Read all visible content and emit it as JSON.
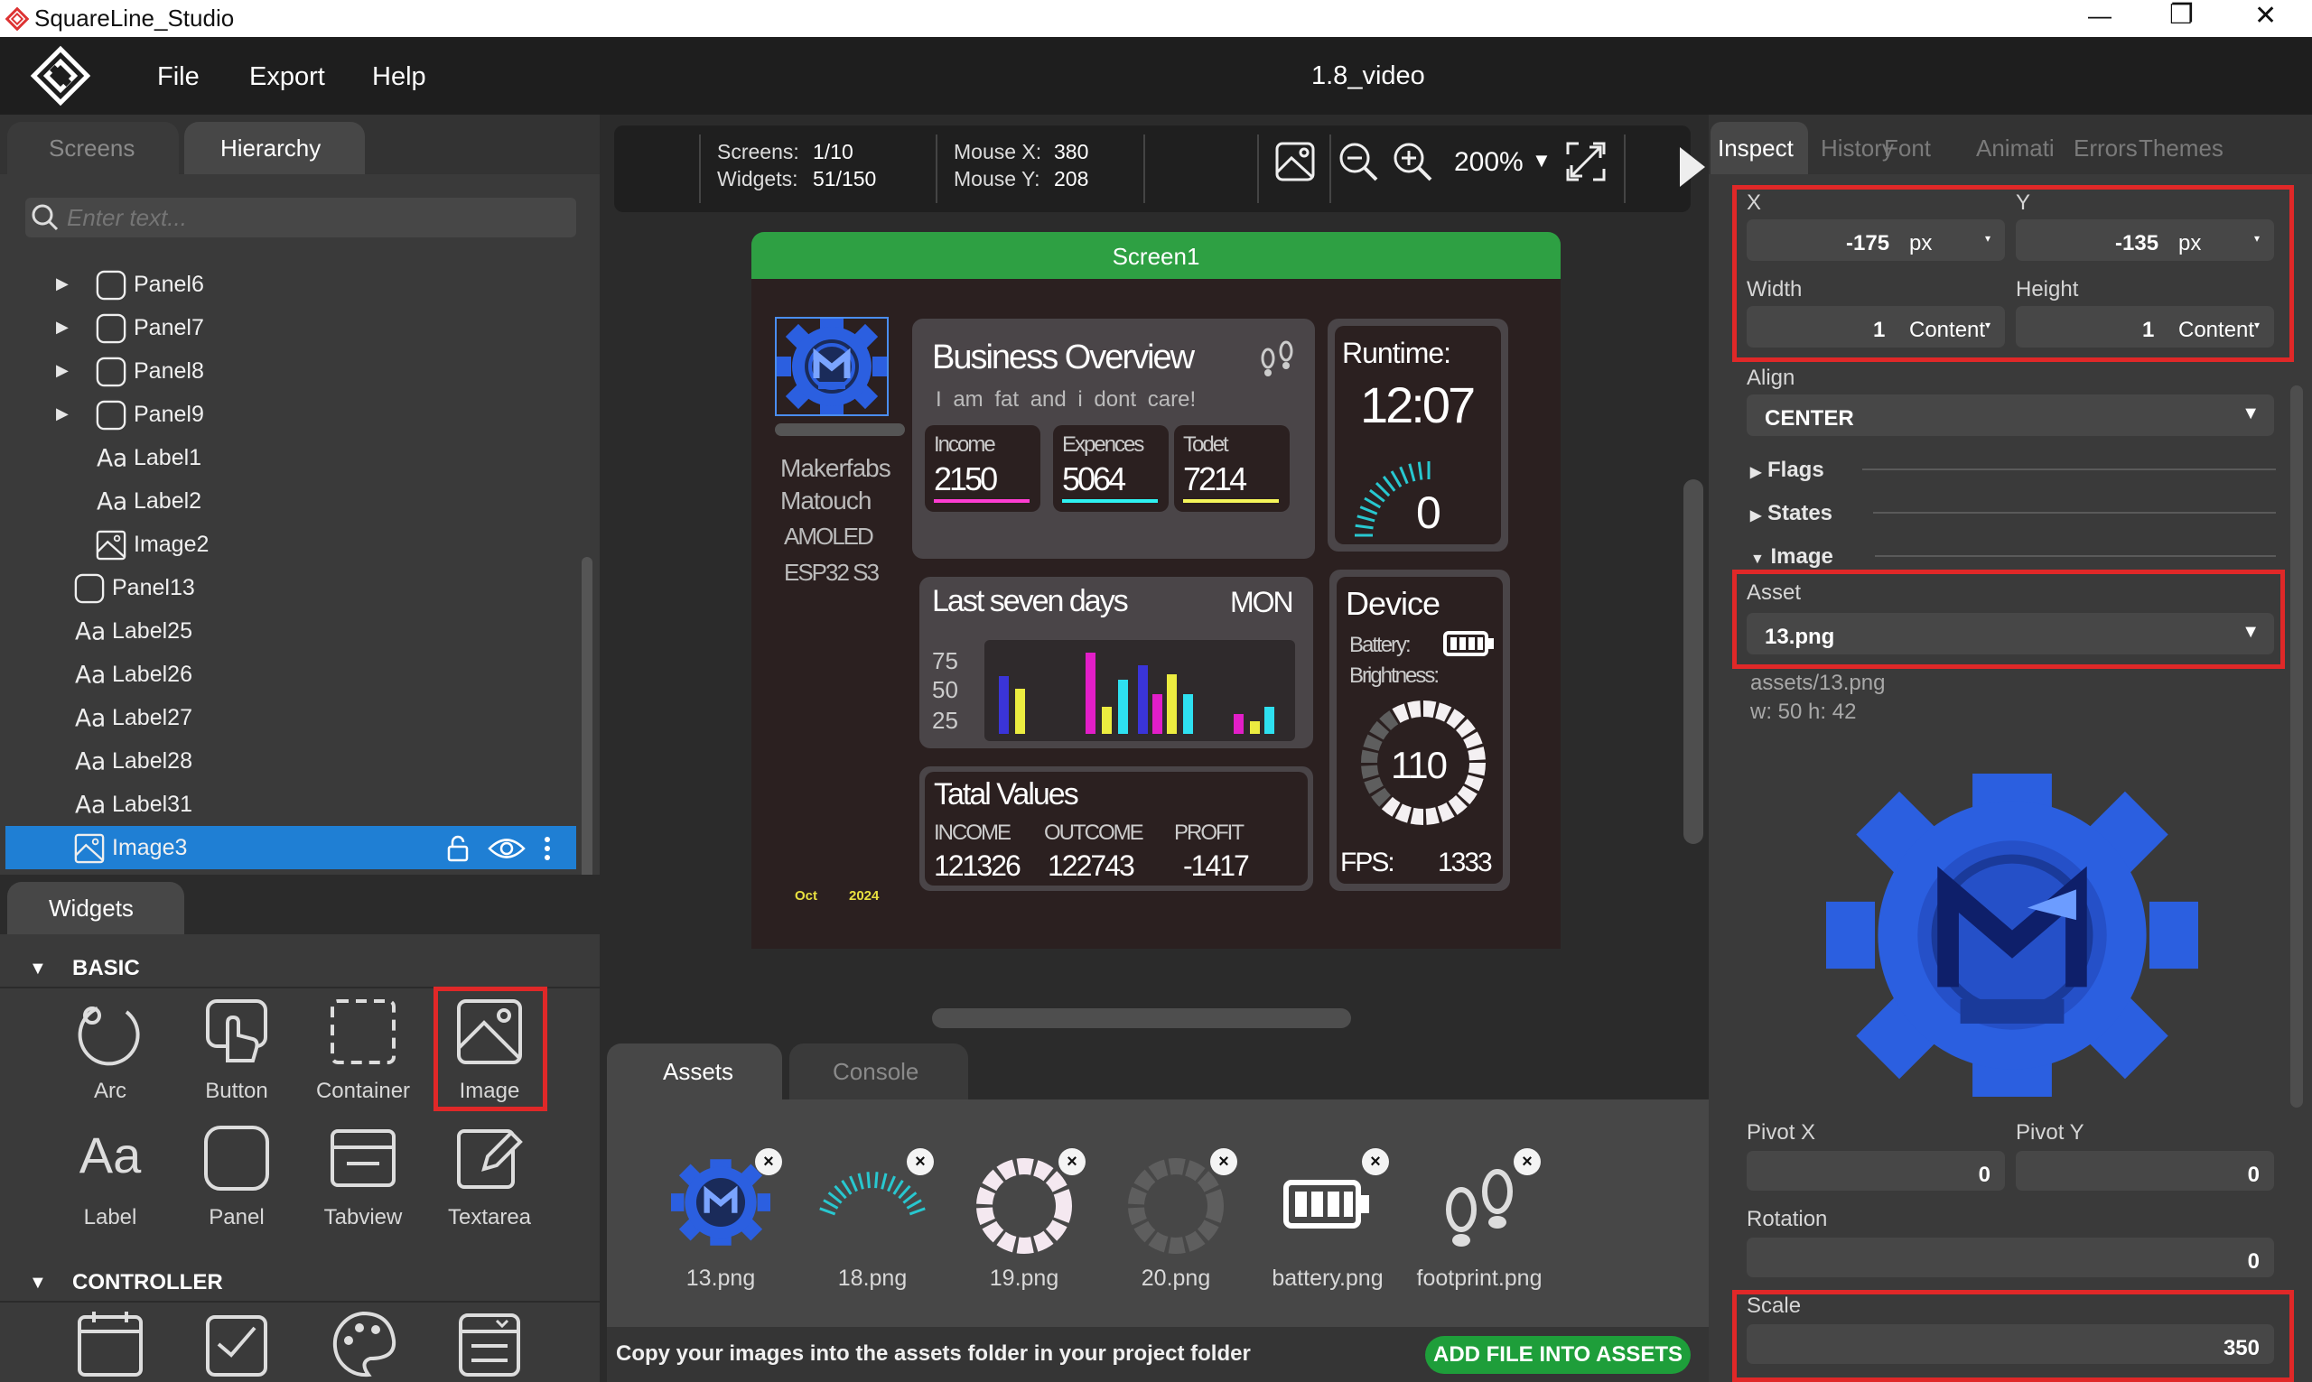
{
  "window": {
    "title": "SquareLine_Studio",
    "minimize": "—",
    "maximize": "❐",
    "close": "✕"
  },
  "menu": {
    "file": "File",
    "export": "Export",
    "help": "Help",
    "project": "1.8_video"
  },
  "left": {
    "tabs": {
      "screens": "Screens",
      "hierarchy": "Hierarchy"
    },
    "search_placeholder": "Enter text...",
    "items": [
      {
        "label": "Panel6",
        "type": "panel",
        "indent": 1,
        "arrow": true
      },
      {
        "label": "Panel7",
        "type": "panel",
        "indent": 1,
        "arrow": true
      },
      {
        "label": "Panel8",
        "type": "panel",
        "indent": 1,
        "arrow": true
      },
      {
        "label": "Panel9",
        "type": "panel",
        "indent": 1,
        "arrow": true
      },
      {
        "label": "Label1",
        "type": "label",
        "indent": 1,
        "arrow": false
      },
      {
        "label": "Label2",
        "type": "label",
        "indent": 1,
        "arrow": false
      },
      {
        "label": "Image2",
        "type": "image",
        "indent": 1,
        "arrow": false
      },
      {
        "label": "Panel13",
        "type": "panel",
        "indent": 0,
        "arrow": false
      },
      {
        "label": "Label25",
        "type": "label",
        "indent": 0,
        "arrow": false
      },
      {
        "label": "Label26",
        "type": "label",
        "indent": 0,
        "arrow": false
      },
      {
        "label": "Label27",
        "type": "label",
        "indent": 0,
        "arrow": false
      },
      {
        "label": "Label28",
        "type": "label",
        "indent": 0,
        "arrow": false
      },
      {
        "label": "Label31",
        "type": "label",
        "indent": 0,
        "arrow": false
      },
      {
        "label": "Image3",
        "type": "image",
        "indent": 0,
        "arrow": false,
        "selected": true
      }
    ],
    "widgets_tab": "Widgets",
    "basic": "BASIC",
    "controller": "CONTROLLER",
    "widgets": [
      "Arc",
      "Button",
      "Container",
      "Image",
      "Label",
      "Panel",
      "Tabview",
      "Textarea"
    ]
  },
  "toolbar": {
    "screens_label": "Screens:",
    "screens_value": "1/10",
    "widgets_label": "Widgets:",
    "widgets_value": "51/150",
    "mousex_label": "Mouse X:",
    "mousex_value": "380",
    "mousey_label": "Mouse Y:",
    "mousey_value": "208",
    "zoom": "200%"
  },
  "screen": {
    "title": "Screen1",
    "device_name": [
      "Makerfabs",
      "Matouch",
      "AMOLED",
      "ESP32 S3"
    ],
    "date": {
      "month": "Oct",
      "year": "2024"
    },
    "overview": {
      "title": "Business Overview",
      "subtitle": "I am fat and i dont care!",
      "stats": [
        {
          "label": "Income",
          "value": "2150",
          "color": "#ff3dd2"
        },
        {
          "label": "Expences",
          "value": "5064",
          "color": "#2ef2f2"
        },
        {
          "label": "Todet",
          "value": "7214",
          "color": "#f6f65a"
        }
      ]
    },
    "runtime": {
      "label": "Runtime:",
      "time": "12:07",
      "value": "0"
    },
    "week": {
      "title": "Last seven days",
      "day": "MON",
      "ticks": [
        "75",
        "50",
        "25"
      ]
    },
    "device": {
      "title": "Device",
      "battery": "Battery:",
      "brightness": "Brightness:",
      "value": "110",
      "fps_label": "FPS:",
      "fps_value": "1333"
    },
    "totals": {
      "title": "Tatal Values",
      "items": [
        {
          "label": "INCOME",
          "value": "121326"
        },
        {
          "label": "OUTCOME",
          "value": "122743"
        },
        {
          "label": "PROFIT",
          "value": "-1417"
        }
      ]
    }
  },
  "bottom": {
    "tabs": {
      "assets": "Assets",
      "console": "Console"
    },
    "assets": [
      "13.png",
      "18.png",
      "19.png",
      "20.png",
      "battery.png",
      "footprint.png"
    ],
    "hint": "Copy your images into the assets folder in your project folder",
    "add_button": "ADD FILE INTO ASSETS"
  },
  "inspector": {
    "tabs": [
      "Inspect",
      "History",
      "Font",
      "Animati",
      "Errors",
      "Themes"
    ],
    "x_label": "X",
    "x_value": "-175",
    "x_unit": "px",
    "y_label": "Y",
    "y_value": "-135",
    "y_unit": "px",
    "w_label": "Width",
    "w_value": "1",
    "w_unit": "Content",
    "h_label": "Height",
    "h_value": "1",
    "h_unit": "Content",
    "align_label": "Align",
    "align_value": "CENTER",
    "flags": "Flags",
    "states": "States",
    "image": "Image",
    "asset_label": "Asset",
    "asset_value": "13.png",
    "asset_path": "assets/13.png",
    "asset_size": "w: 50  h: 42",
    "pivotx_label": "Pivot X",
    "pivotx_value": "0",
    "pivoty_label": "Pivot Y",
    "pivoty_value": "0",
    "rotation_label": "Rotation",
    "rotation_value": "0",
    "scale_label": "Scale",
    "scale_value": "350"
  },
  "colors": {
    "accent_blue": "#1f7fd4",
    "screen_green": "#2ea043",
    "highlight_red": "#e02828",
    "add_green": "#1e9e3a",
    "logo_blue": "#2b5fe0"
  }
}
